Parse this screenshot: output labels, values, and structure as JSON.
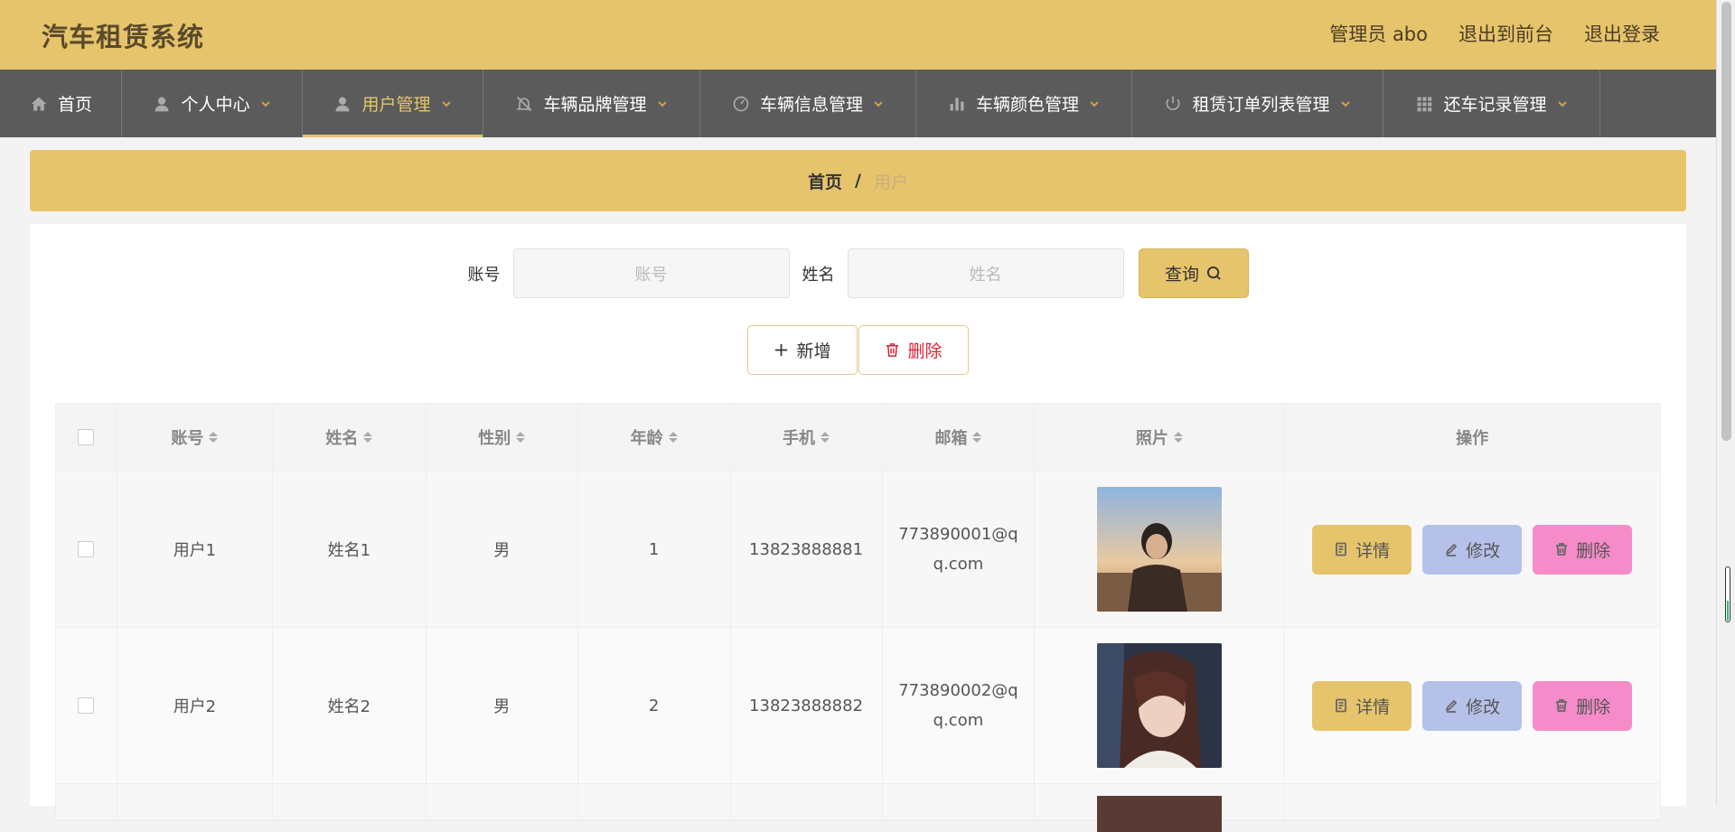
{
  "header": {
    "title": "汽车租赁系统",
    "links": [
      "管理员 abo",
      "退出到前台",
      "退出登录"
    ]
  },
  "nav": [
    {
      "label": "首页",
      "icon": "home-icon",
      "has_dropdown": false,
      "active": false
    },
    {
      "label": "个人中心",
      "icon": "user-icon",
      "has_dropdown": true,
      "active": false
    },
    {
      "label": "用户管理",
      "icon": "user-icon",
      "has_dropdown": true,
      "active": true
    },
    {
      "label": "车辆品牌管理",
      "icon": "bell-off-icon",
      "has_dropdown": true,
      "active": false
    },
    {
      "label": "车辆信息管理",
      "icon": "gauge-icon",
      "has_dropdown": true,
      "active": false
    },
    {
      "label": "车辆颜色管理",
      "icon": "bar-chart-icon",
      "has_dropdown": true,
      "active": false
    },
    {
      "label": "租赁订单列表管理",
      "icon": "power-icon",
      "has_dropdown": true,
      "active": false
    },
    {
      "label": "还车记录管理",
      "icon": "grid-icon",
      "has_dropdown": true,
      "active": false
    }
  ],
  "breadcrumb": {
    "home": "首页",
    "separator": "/",
    "current": "用户"
  },
  "search": {
    "account_label": "账号",
    "account_placeholder": "账号",
    "name_label": "姓名",
    "name_placeholder": "姓名",
    "query_button": "查询"
  },
  "actions": {
    "add_button": "新增",
    "delete_button": "删除"
  },
  "table": {
    "columns": [
      "账号",
      "姓名",
      "性别",
      "年龄",
      "手机",
      "邮箱",
      "照片",
      "操作"
    ],
    "rows": [
      {
        "account": "用户1",
        "name": "姓名1",
        "gender": "男",
        "age": "1",
        "phone": "13823888881",
        "email": "773890001@qq.com"
      },
      {
        "account": "用户2",
        "name": "姓名2",
        "gender": "男",
        "age": "2",
        "phone": "13823888882",
        "email": "773890002@qq.com"
      }
    ],
    "row_actions": {
      "detail": "详情",
      "edit": "修改",
      "delete": "删除"
    }
  },
  "colors": {
    "accent": "#e6c46c",
    "nav_bg": "#5b5b5b",
    "edit": "#b6c1ea",
    "delete": "#f58bc9"
  }
}
